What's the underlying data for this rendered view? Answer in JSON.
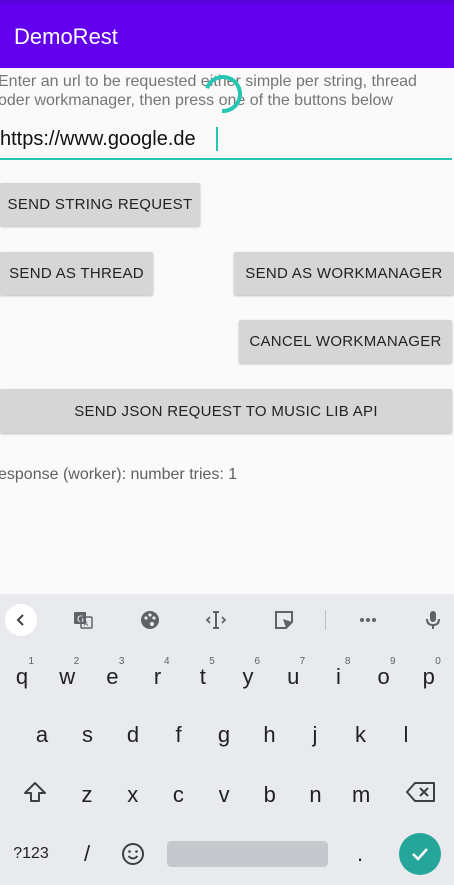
{
  "app": {
    "title": "DemoRest"
  },
  "form": {
    "hint": "Enter an url to be requested either simple per string, thread\noder workmanager, then press one of the buttons below",
    "url_value": "https://www.google.de"
  },
  "buttons": {
    "send_string": "SEND STRING REQUEST",
    "send_thread": "SEND AS THREAD",
    "send_workmanager": "SEND AS WORKMANAGER",
    "cancel_workmanager": "CANCEL WORKMANAGER",
    "send_json": "SEND JSON REQUEST TO MUSIC LIB API"
  },
  "response": {
    "text": "esponse (worker): number tries: 1"
  },
  "colors": {
    "primary": "#6200ee",
    "accent": "#26c6b4",
    "button": "#d6d6d6",
    "enter": "#26a69a"
  },
  "keyboard": {
    "toolbar_icons": [
      "back-icon",
      "translate-icon",
      "palette-icon",
      "text-cursor-icon",
      "sticker-icon",
      "more-icon",
      "mic-icon"
    ],
    "row1": [
      {
        "k": "q",
        "n": "1"
      },
      {
        "k": "w",
        "n": "2"
      },
      {
        "k": "e",
        "n": "3"
      },
      {
        "k": "r",
        "n": "4"
      },
      {
        "k": "t",
        "n": "5"
      },
      {
        "k": "y",
        "n": "6"
      },
      {
        "k": "u",
        "n": "7"
      },
      {
        "k": "i",
        "n": "8"
      },
      {
        "k": "o",
        "n": "9"
      },
      {
        "k": "p",
        "n": "0"
      }
    ],
    "row2": [
      "a",
      "s",
      "d",
      "f",
      "g",
      "h",
      "j",
      "k",
      "l"
    ],
    "row3": [
      "z",
      "x",
      "c",
      "v",
      "b",
      "n",
      "m"
    ],
    "symbols_label": "?123",
    "slash": "/",
    "period": "."
  }
}
